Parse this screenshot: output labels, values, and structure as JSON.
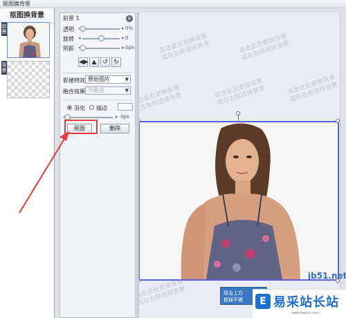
{
  "window": {
    "title": "抠图换背景"
  },
  "layers": {
    "title": "抠图换背景",
    "fg_tab": "前景",
    "bg_tab": "背景"
  },
  "props": {
    "head": "前景 1",
    "opacity": {
      "label": "透明",
      "value": "0%",
      "level": 0.0
    },
    "rotate": {
      "label": "旋转",
      "value": "0",
      "level": 0.5
    },
    "shadow": {
      "label": "阴影",
      "value": "0px",
      "level": 0.0
    },
    "tools": [
      "flip-horizontal-icon",
      "flip-vertical-icon",
      "rotate-left-icon",
      "rotate-right-icon"
    ],
    "effect_label": "影楼特效",
    "effect_value": "原始图片",
    "blend_label": "融合效果",
    "blend_value": "不融合",
    "feather_label": "羽化",
    "stroke_label": "描边",
    "feather": {
      "value": "0px",
      "level": 0.0
    },
    "cutout_label": "抠图",
    "delete_label": "删除"
  },
  "canvas": {
    "watermark_line1": "双击此处更换背景",
    "watermark_line2": "或在右侧选择背景",
    "tooltip_line1": "双击上方",
    "tooltip_line2": "抠掉不需",
    "site_text": "jb51.net",
    "brand_name": "易采站长站",
    "brand_url": "www.easck.com"
  },
  "colors": {
    "selection": "#5b5fe0",
    "highlight": "#e23b3b",
    "brand": "#1d6fd1"
  }
}
